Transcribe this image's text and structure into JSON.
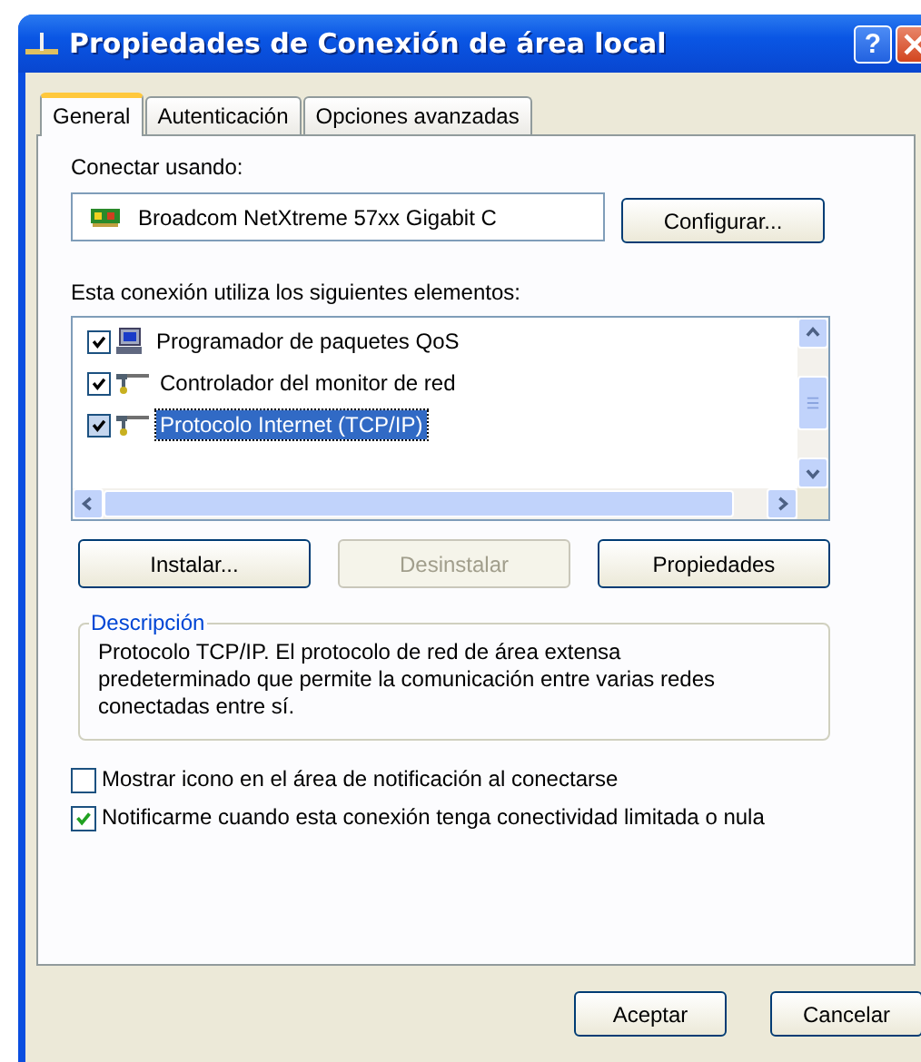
{
  "window": {
    "title": "Propiedades de Conexión de área local",
    "help_button": "?"
  },
  "tabs": [
    {
      "label": "General",
      "selected": true
    },
    {
      "label": "Autenticación",
      "selected": false
    },
    {
      "label": "Opciones avanzadas",
      "selected": false
    }
  ],
  "connect_using": {
    "label": "Conectar usando:",
    "adapter": "Broadcom NetXtreme 57xx Gigabit C",
    "button": "Configurar..."
  },
  "components": {
    "label": "Esta conexión utiliza los siguientes elementos:",
    "items": [
      {
        "kind": "scheduler",
        "name": "Programador de paquetes QoS",
        "checked": true,
        "selected": false
      },
      {
        "kind": "monitor",
        "name": "Controlador del monitor de red",
        "checked": true,
        "selected": false
      },
      {
        "kind": "protocol",
        "name": "Protocolo Internet (TCP/IP)",
        "checked": true,
        "selected": true
      }
    ]
  },
  "component_buttons": [
    {
      "label": "Instalar...",
      "disabled": false
    },
    {
      "label": "Desinstalar",
      "disabled": true
    },
    {
      "label": "Propiedades",
      "disabled": false
    }
  ],
  "description": {
    "title": "Descripción",
    "text": "Protocolo TCP/IP. El protocolo de red de área extensa predeterminado que permite la comunicación entre varias redes conectadas entre sí."
  },
  "options": [
    {
      "label": "Mostrar icono en el área de notificación al conectarse",
      "checked": false
    },
    {
      "label": "Notificarme cuando esta conexión tenga conectividad limitada o nula",
      "checked": true
    }
  ],
  "buttons": [
    "Aceptar",
    "Cancelar"
  ]
}
